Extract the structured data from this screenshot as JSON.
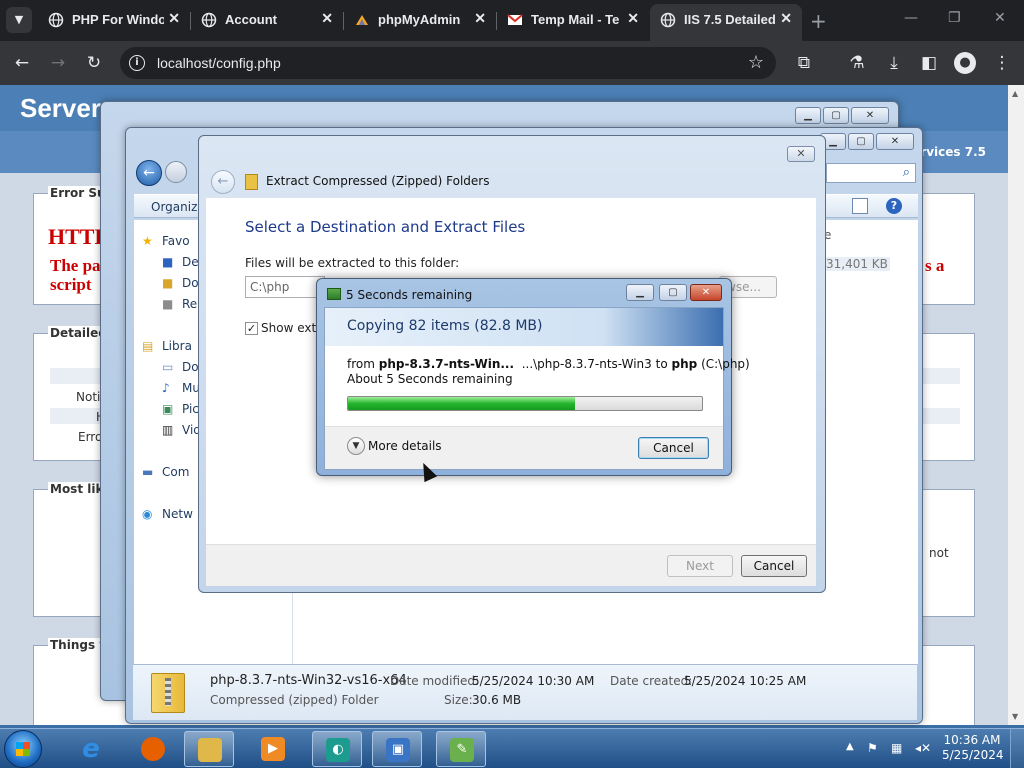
{
  "browser": {
    "tabs": [
      {
        "title": "PHP For Windo",
        "favicon": "php-globe-icon",
        "active": false
      },
      {
        "title": "Account",
        "favicon": "globe-icon",
        "active": false
      },
      {
        "title": "phpMyAdmin",
        "favicon": "phpmyadmin-icon",
        "active": false
      },
      {
        "title": "Temp Mail - Te",
        "favicon": "mail-icon",
        "active": false
      },
      {
        "title": "IIS 7.5 Detailed",
        "favicon": "globe-icon",
        "active": true
      }
    ],
    "url": "localhost/config.php",
    "new_tab_glyph": "+",
    "window_controls": [
      "—",
      "❐",
      "✕"
    ]
  },
  "iis_page": {
    "heading": "Server",
    "header_suffix": "ervices 7.5",
    "boxes": {
      "error_summary": "Error Su",
      "detailed": "Detailed",
      "most_likely": "Most like",
      "things": "Things y"
    },
    "error_big": "HTTF",
    "error_line1": "The pa",
    "error_line2": "script",
    "error_tail": "s a",
    "detail_rows": [
      "Notif",
      "H",
      "Erro"
    ],
    "not_word": "not"
  },
  "explorer_back": {
    "nav_favorites": "Favo",
    "nav_items": [
      "De",
      "Do",
      "Re"
    ],
    "nav_libraries": "Libra",
    "lib_items": [
      "Do",
      "Mu",
      "Pic",
      "Vid"
    ],
    "nav_computer": "Com",
    "nav_network": "Netw",
    "organize": "Organize",
    "size_col": "e",
    "size_value": "31,401 KB"
  },
  "details_bar": {
    "filename": "php-8.3.7-nts-Win32-vs16-x64",
    "type": "Compressed (zipped) Folder",
    "modified_label": "Date modified:",
    "modified_value": "5/25/2024 10:30 AM",
    "created_label": "Date created:",
    "created_value": "5/25/2024 10:25 AM",
    "size_label": "Size:",
    "size_value": "30.6 MB"
  },
  "wizard": {
    "title": "Extract Compressed (Zipped) Folders",
    "heading": "Select a Destination and Extract Files",
    "files_label": "Files will be extracted to this folder:",
    "path_value": "C:\\php",
    "browse_label": "Browse...",
    "browse_fragment": "wse...",
    "show_checkbox": "Show extra",
    "checked": true,
    "next_label": "Next",
    "cancel_label": "Cancel"
  },
  "progress": {
    "window_title": "5 Seconds remaining",
    "heading": "Copying 82 items (82.8 MB)",
    "from_label": "from",
    "from_name": "php-8.3.7-nts-Win...",
    "from_path": "...\\php-8.3.7-nts-Win3",
    "to_label": "to",
    "to_name": "php",
    "to_path": "(C:\\php)",
    "remaining": "About 5 Seconds remaining",
    "progress_fraction": 0.64,
    "more_details": "More details",
    "cancel_label": "Cancel"
  },
  "taskbar": {
    "apps": [
      {
        "name": "internet-explorer",
        "glyph": "e",
        "color": "#2f8de4",
        "open": false
      },
      {
        "name": "firefox",
        "glyph": "",
        "color": "#e66000",
        "open": false
      },
      {
        "name": "windows-explorer",
        "glyph": "",
        "color": "#e0b84a",
        "open": true
      },
      {
        "name": "media-player",
        "glyph": "▶",
        "color": "#f08a24",
        "open": false
      },
      {
        "name": "windows-media",
        "glyph": "◐",
        "color": "#1e9b8f",
        "open": true
      },
      {
        "name": "system-tool",
        "glyph": "▣",
        "color": "#3a74c4",
        "open": true
      },
      {
        "name": "notepadpp",
        "glyph": "✎",
        "color": "#6ab04c",
        "open": true
      }
    ],
    "time": "10:36 AM",
    "date": "5/25/2024"
  }
}
